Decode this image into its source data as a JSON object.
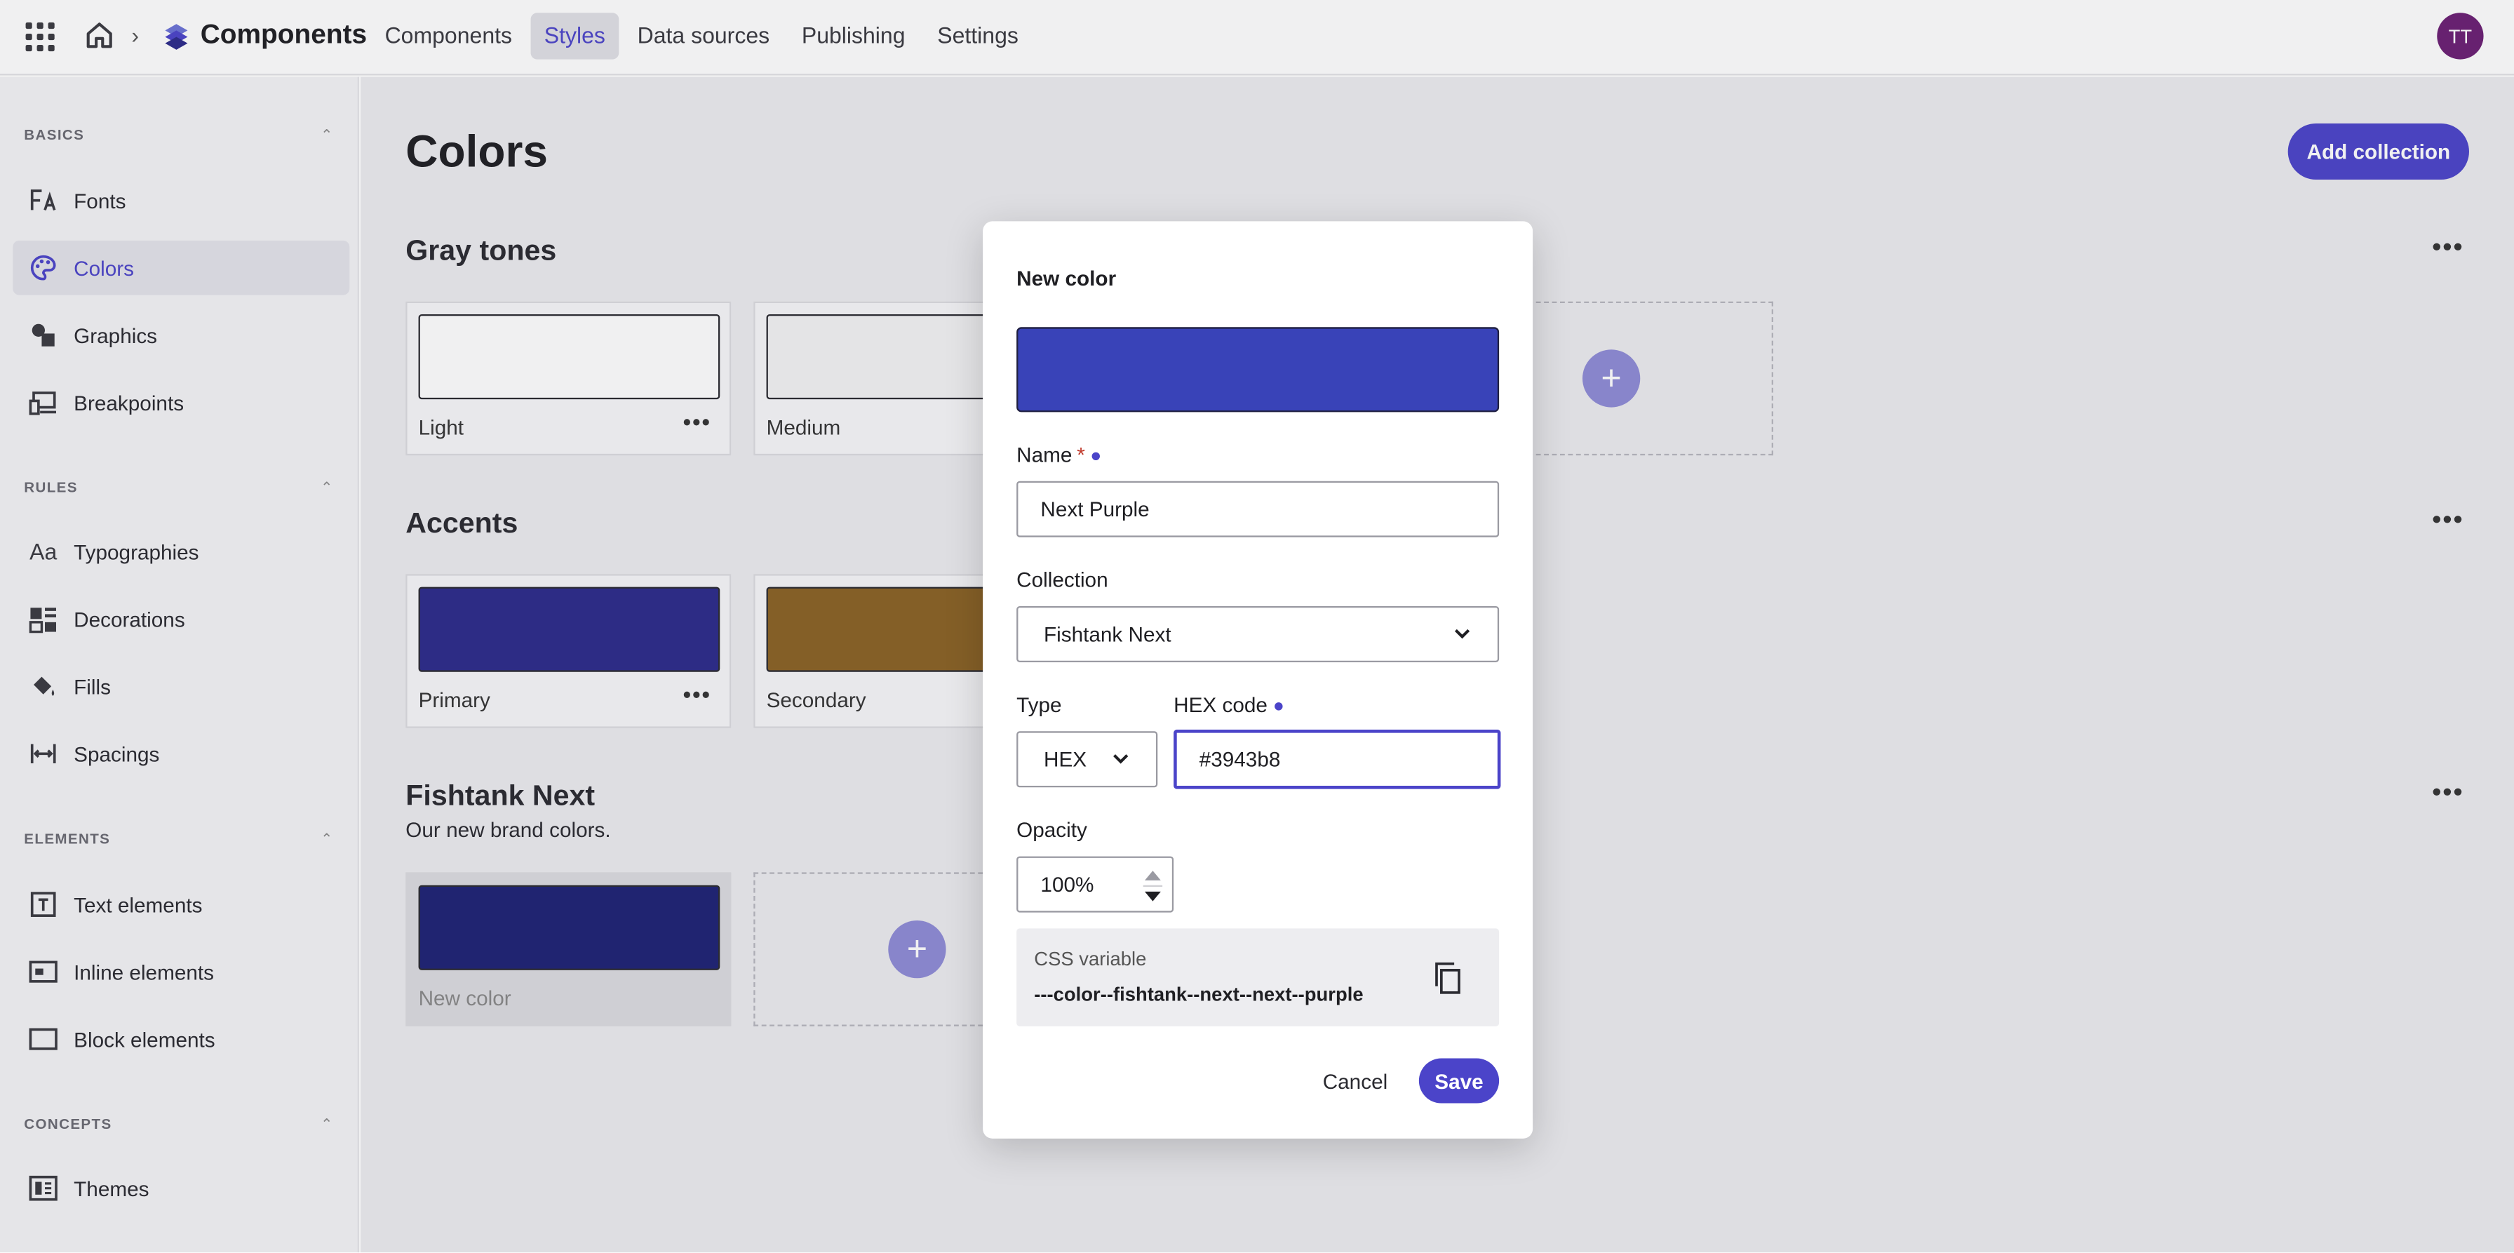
{
  "topbar": {
    "app_title": "Components",
    "nav": [
      "Components",
      "Styles",
      "Data sources",
      "Publishing",
      "Settings"
    ],
    "active_nav": "Styles",
    "avatar_initials": "TT"
  },
  "sidebar": {
    "sections": [
      {
        "title": "BASICS",
        "items": [
          "Fonts",
          "Colors",
          "Graphics",
          "Breakpoints"
        ]
      },
      {
        "title": "RULES",
        "items": [
          "Typographies",
          "Decorations",
          "Fills",
          "Spacings"
        ]
      },
      {
        "title": "ELEMENTS",
        "items": [
          "Text elements",
          "Inline elements",
          "Block elements"
        ]
      },
      {
        "title": "CONCEPTS",
        "items": [
          "Themes"
        ]
      }
    ],
    "active_item": "Colors"
  },
  "main": {
    "title": "Colors",
    "add_collection_label": "Add collection",
    "collections": [
      {
        "title": "Gray tones",
        "cards": [
          {
            "label": "Light",
            "color": "#ffffff"
          },
          {
            "label": "Medium",
            "color": "#f2f2f4"
          }
        ]
      },
      {
        "title": "Accents",
        "cards": [
          {
            "label": "Primary",
            "color": "#2c2b8a"
          },
          {
            "label": "Secondary",
            "color": "#8a6224"
          }
        ]
      },
      {
        "title": "Fishtank Next",
        "description": "Our new brand colors.",
        "cards": [
          {
            "label": "New color",
            "color": "#1e2275"
          }
        ]
      }
    ]
  },
  "modal": {
    "title": "New color",
    "swatch_color": "#3943b8",
    "name_label": "Name",
    "name_required_mark": "*",
    "name_value": "Next Purple",
    "collection_label": "Collection",
    "collection_value": "Fishtank Next",
    "type_label": "Type",
    "type_value": "HEX",
    "hex_label": "HEX code",
    "hex_value": "#3943b8",
    "opacity_label": "Opacity",
    "opacity_value": "100%",
    "css_variable_label": "CSS variable",
    "css_variable_value": "---color--fishtank--next--next--purple",
    "cancel_label": "Cancel",
    "save_label": "Save"
  },
  "colors": {
    "accent": "#4b44c9",
    "avatar": "#6b1f73"
  }
}
